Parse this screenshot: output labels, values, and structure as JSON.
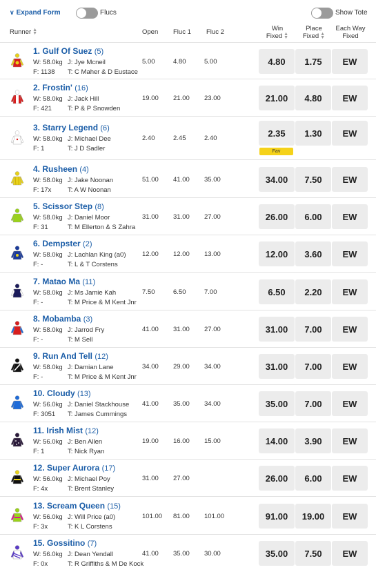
{
  "toolbar": {
    "expand_form": "Expand Form",
    "flucs": "Flucs",
    "show_tote": "Show Tote"
  },
  "header": {
    "runner": "Runner",
    "open": "Open",
    "fluc1": "Fluc 1",
    "fluc2": "Fluc 2",
    "win_fixed_1": "Win",
    "win_fixed_2": "Fixed",
    "place_fixed_1": "Place",
    "place_fixed_2": "Fixed",
    "ew_1": "Each Way",
    "ew_2": "Fixed"
  },
  "silk_colors": [
    "#d81e1e",
    "#e8d21a",
    "#1a3a9a",
    "#ffffff",
    "#6bc23a",
    "#111111",
    "#1e6bd8",
    "#2a1a3a",
    "#5a3ac8"
  ],
  "runners": [
    {
      "name": "1. Gulf Of Suez",
      "barrier": "(5)",
      "weight": "W: 58.0kg",
      "jockey": "J: Jye Mcneil",
      "form": "F: 1138",
      "trainer": "T: C Maher & D Eustace",
      "open": "5.00",
      "fluc1": "4.80",
      "fluc2": "5.00",
      "win": "4.80",
      "place": "1.75",
      "ew": "EW",
      "fav": "",
      "silk": "gulf"
    },
    {
      "name": "2. Frostin'",
      "barrier": "(16)",
      "weight": "W: 58.0kg",
      "jockey": "J: Jack Hill",
      "form": "F: 421",
      "trainer": "T: P & P Snowden",
      "open": "19.00",
      "fluc1": "21.00",
      "fluc2": "23.00",
      "win": "21.00",
      "place": "4.80",
      "ew": "EW",
      "fav": "",
      "silk": "frostin"
    },
    {
      "name": "3. Starry Legend",
      "barrier": "(6)",
      "weight": "W: 58.0kg",
      "jockey": "J: Michael Dee",
      "form": "F: 1",
      "trainer": "T: J D Sadler",
      "open": "2.40",
      "fluc1": "2.45",
      "fluc2": "2.40",
      "win": "2.35",
      "place": "1.30",
      "ew": "EW",
      "fav": "Fav",
      "silk": "starry"
    },
    {
      "name": "4. Rusheen",
      "barrier": "(4)",
      "weight": "W: 58.0kg",
      "jockey": "J: Jake Noonan",
      "form": "F: 17x",
      "trainer": "T: A W Noonan",
      "open": "51.00",
      "fluc1": "41.00",
      "fluc2": "35.00",
      "win": "34.00",
      "place": "7.50",
      "ew": "EW",
      "fav": "",
      "silk": "rusheen"
    },
    {
      "name": "5. Scissor Step",
      "barrier": "(8)",
      "weight": "W: 58.0kg",
      "jockey": "J: Daniel Moor",
      "form": "F: 31",
      "trainer": "T: M Ellerton & S Zahra",
      "open": "31.00",
      "fluc1": "31.00",
      "fluc2": "27.00",
      "win": "26.00",
      "place": "6.00",
      "ew": "EW",
      "fav": "",
      "silk": "scissor"
    },
    {
      "name": "6. Dempster",
      "barrier": "(2)",
      "weight": "W: 58.0kg",
      "jockey": "J: Lachlan King (a0)",
      "form": "F: -",
      "trainer": "T: L & T Corstens",
      "open": "12.00",
      "fluc1": "12.00",
      "fluc2": "13.00",
      "win": "12.00",
      "place": "3.60",
      "ew": "EW",
      "fav": "",
      "silk": "dempster"
    },
    {
      "name": "7. Matao Ma",
      "barrier": "(11)",
      "weight": "W: 58.0kg",
      "jockey": "J: Ms Jamie Kah",
      "form": "F: -",
      "trainer": "T: M Price & M Kent Jnr",
      "open": "7.50",
      "fluc1": "6.50",
      "fluc2": "7.00",
      "win": "6.50",
      "place": "2.20",
      "ew": "EW",
      "fav": "",
      "silk": "matao"
    },
    {
      "name": "8. Mobamba",
      "barrier": "(3)",
      "weight": "W: 58.0kg",
      "jockey": "J: Jarrod Fry",
      "form": "F: -",
      "trainer": "T: M Sell",
      "open": "41.00",
      "fluc1": "31.00",
      "fluc2": "27.00",
      "win": "31.00",
      "place": "7.00",
      "ew": "EW",
      "fav": "",
      "silk": "mobamba"
    },
    {
      "name": "9. Run And Tell",
      "barrier": "(12)",
      "weight": "W: 58.0kg",
      "jockey": "J: Damian Lane",
      "form": "F: -",
      "trainer": "T: M Price & M Kent Jnr",
      "open": "34.00",
      "fluc1": "29.00",
      "fluc2": "34.00",
      "win": "31.00",
      "place": "7.00",
      "ew": "EW",
      "fav": "",
      "silk": "runandtell"
    },
    {
      "name": "10. Cloudy",
      "barrier": "(13)",
      "weight": "W: 56.0kg",
      "jockey": "J: Daniel Stackhouse",
      "form": "F: 3051",
      "trainer": "T: James Cummings",
      "open": "41.00",
      "fluc1": "35.00",
      "fluc2": "34.00",
      "win": "35.00",
      "place": "7.00",
      "ew": "EW",
      "fav": "",
      "silk": "cloudy"
    },
    {
      "name": "11. Irish Mist",
      "barrier": "(12)",
      "weight": "W: 56.0kg",
      "jockey": "J: Ben Allen",
      "form": "F: 1",
      "trainer": "T: Nick Ryan",
      "open": "19.00",
      "fluc1": "16.00",
      "fluc2": "15.00",
      "win": "14.00",
      "place": "3.90",
      "ew": "EW",
      "fav": "",
      "silk": "irish"
    },
    {
      "name": "12. Super Aurora",
      "barrier": "(17)",
      "weight": "W: 56.0kg",
      "jockey": "J: Michael Poy",
      "form": "F: 4x",
      "trainer": "T: Brent Stanley",
      "open": "31.00",
      "fluc1": "27.00",
      "fluc2": "",
      "win": "26.00",
      "place": "6.00",
      "ew": "EW",
      "fav": "",
      "silk": "aurora"
    },
    {
      "name": "13. Scream Queen",
      "barrier": "(15)",
      "weight": "W: 56.0kg",
      "jockey": "J: Will Price (a0)",
      "form": "F: 3x",
      "trainer": "T: K L Corstens",
      "open": "101.00",
      "fluc1": "81.00",
      "fluc2": "101.00",
      "win": "91.00",
      "place": "19.00",
      "ew": "EW",
      "fav": "",
      "silk": "scream"
    },
    {
      "name": "15. Gossitino",
      "barrier": "(7)",
      "weight": "W: 56.0kg",
      "jockey": "J: Dean Yendall",
      "form": "F: 0x",
      "trainer": "T: R Griffiths & M De Kock",
      "open": "41.00",
      "fluc1": "35.00",
      "fluc2": "30.00",
      "win": "35.00",
      "place": "7.50",
      "ew": "EW",
      "fav": "",
      "silk": "gossitino"
    }
  ]
}
